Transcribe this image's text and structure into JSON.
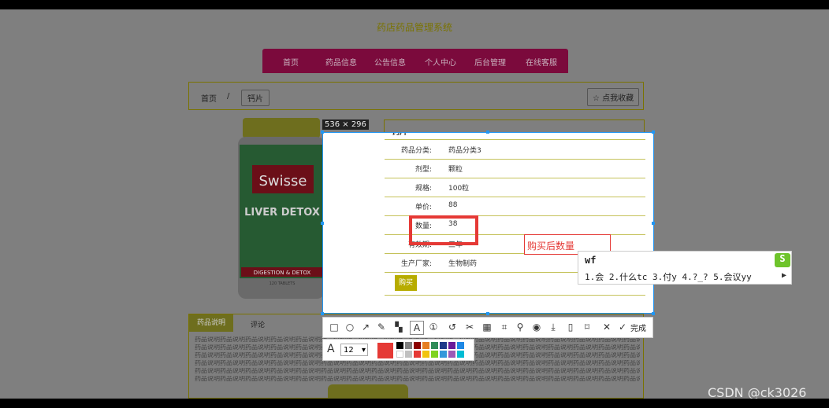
{
  "site": {
    "title": "药店药品管理系统",
    "nav": [
      "首页",
      "药品信息",
      "公告信息",
      "个人中心",
      "后台管理",
      "在线客服"
    ]
  },
  "breadcrumb": {
    "home": "首页",
    "separator": "/",
    "current": "钙片",
    "favorite_label": "☆ 点我收藏"
  },
  "product": {
    "name": "钙片",
    "image_text": {
      "brand": "Swisse",
      "line": "LIVER DETOX",
      "sub": "DIGESTION & DETOX",
      "count": "120 TABLETS"
    },
    "fields": [
      {
        "key": "药品分类:",
        "value": "药品分类3"
      },
      {
        "key": "剂型:",
        "value": "颗粒"
      },
      {
        "key": "规格:",
        "value": "100粒"
      },
      {
        "key": "单价:",
        "value": "88"
      },
      {
        "key": "数量:",
        "value": "38"
      },
      {
        "key": "有效期:",
        "value": "三年"
      },
      {
        "key": "生产厂家:",
        "value": "生物制药"
      }
    ],
    "buy_label": "购买"
  },
  "tabs": {
    "active": "药品说明",
    "other": "评论",
    "filler": "药品说明药品说明药品说明药品说明药品说明药品说明药品说明药品说明药品说明药品说明药品说明药品说明药品说明药品说明药品说明药品说明药品说明药品说明药品说明"
  },
  "screenshot_tool": {
    "dimensions": "536 × 296",
    "annotation_text": "购买后数量",
    "done_label": "完成",
    "font_size": "12",
    "accent_color": "#2196f3",
    "annotation_color": "#e53935",
    "tools": [
      "rect-icon",
      "ellipse-icon",
      "arrow-icon",
      "pen-icon",
      "mosaic-icon",
      "text-icon",
      "number-icon",
      "undo-icon",
      "scissors-icon",
      "ocr-icon",
      "scan-icon",
      "pin-icon",
      "record-icon",
      "download-icon",
      "phone-icon",
      "bookmark-icon",
      "close-icon",
      "check-icon"
    ],
    "palette": [
      "#000000",
      "#808080",
      "#8b0000",
      "#e67e22",
      "#2e8b57",
      "#1e3a8a",
      "#6a1b9a",
      "#1e88e5",
      "#ffffff",
      "#c0c0c0",
      "#e53935",
      "#f1c40f",
      "#7ed321",
      "#3498db",
      "#9b59b6",
      "#00bcd4"
    ]
  },
  "ime": {
    "input": "wf",
    "candidates": "1.会 2.什么tc 3.付y 4.?_? 5.会议yy"
  },
  "watermark": "CSDN @ck3026"
}
